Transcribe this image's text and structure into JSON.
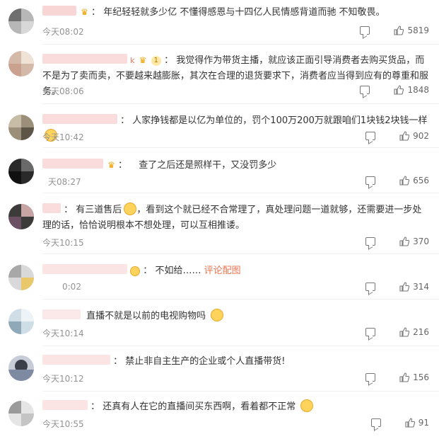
{
  "comments": [
    {
      "text": "年纪轻轻就多少亿 不懂得感恩与十四亿人民情感背道而驰 不知敬畏。",
      "time": "今天08:02",
      "likes": "5819"
    },
    {
      "level": "1",
      "text": "我觉得作为带货主播，就应该正面引导消费者去购买货品，而不是为了卖而卖，不要越来越膨胀，其次在合理的退货要求下，消费者应当得到应有的尊重和服务。",
      "time": "今天08:06",
      "likes": "1848"
    },
    {
      "text": "人家挣钱都是以亿为单位的，罚个100万200万就跟咱们1块钱2块钱一样",
      "time": "今天10:42",
      "likes": "902"
    },
    {
      "text": "查了之后还是照样干，又没罚多少",
      "time": "天08:27",
      "likes": "656"
    },
    {
      "text_a": "有三道售后",
      "text_b": "，看到这个就已经不合常理了，真处理问题一道就够，还需要进一步处理的话，恰恰说明根本不想处理，可以互相推诿。",
      "time": "今天10:15",
      "likes": "370"
    },
    {
      "text": "不如给……",
      "link": "评论配图",
      "time": "0:02",
      "likes": "314"
    },
    {
      "text": "直播不就是以前的电视购物吗",
      "time": "今天10:14",
      "likes": "216"
    },
    {
      "text": "禁止非自主生产的企业或个人直播带货!",
      "time": "今天10:12",
      "likes": "156"
    },
    {
      "text": "还真有人在它的直播间买东西啊，看着都不正常",
      "time": "今天10:55",
      "likes": "91"
    }
  ],
  "icons": {
    "reply": "reply-icon",
    "like": "thumbs-up-icon",
    "vip": "crown-icon"
  },
  "colors": {
    "time": "#939393",
    "link": "#eb7350",
    "accent": "#f2a100"
  }
}
